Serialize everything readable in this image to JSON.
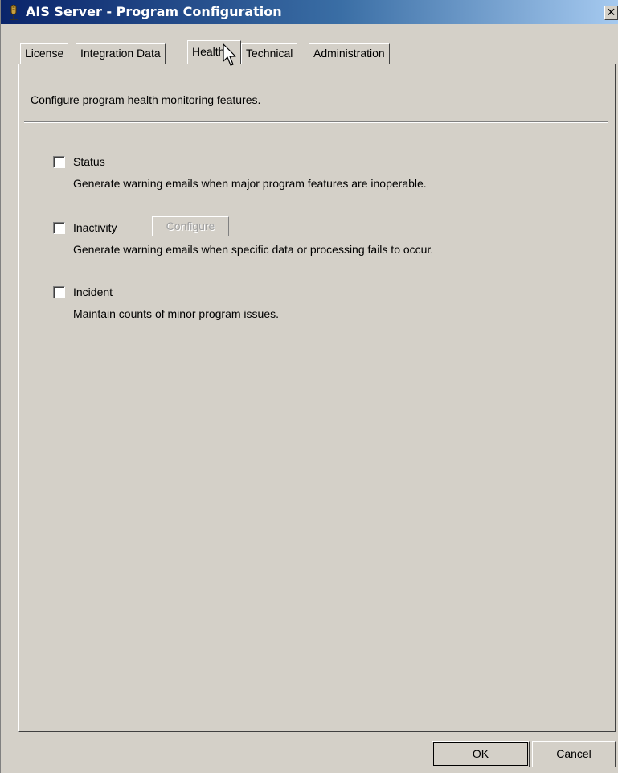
{
  "window": {
    "title": "AIS Server - Program Configuration",
    "close_glyph": "✕"
  },
  "tabs": [
    {
      "label": "License",
      "active": false
    },
    {
      "label": "Integration Data",
      "active": false
    },
    {
      "label": "Health",
      "active": true
    },
    {
      "label": "Technical",
      "active": false
    },
    {
      "label": "Administration",
      "active": false
    }
  ],
  "panel": {
    "description": "Configure program health monitoring features.",
    "options": [
      {
        "label": "Status",
        "checked": false,
        "description": "Generate warning emails when major program features are inoperable."
      },
      {
        "label": "Inactivity",
        "checked": false,
        "description": "Generate warning emails when specific data or processing fails to occur."
      },
      {
        "label": "Incident",
        "checked": false,
        "description": "Maintain counts of minor program issues."
      }
    ],
    "configure_label": "Configure"
  },
  "buttons": {
    "ok": "OK",
    "cancel": "Cancel"
  },
  "icons": {
    "app": "microphone-icon",
    "cursor": "mouse-pointer-icon"
  }
}
